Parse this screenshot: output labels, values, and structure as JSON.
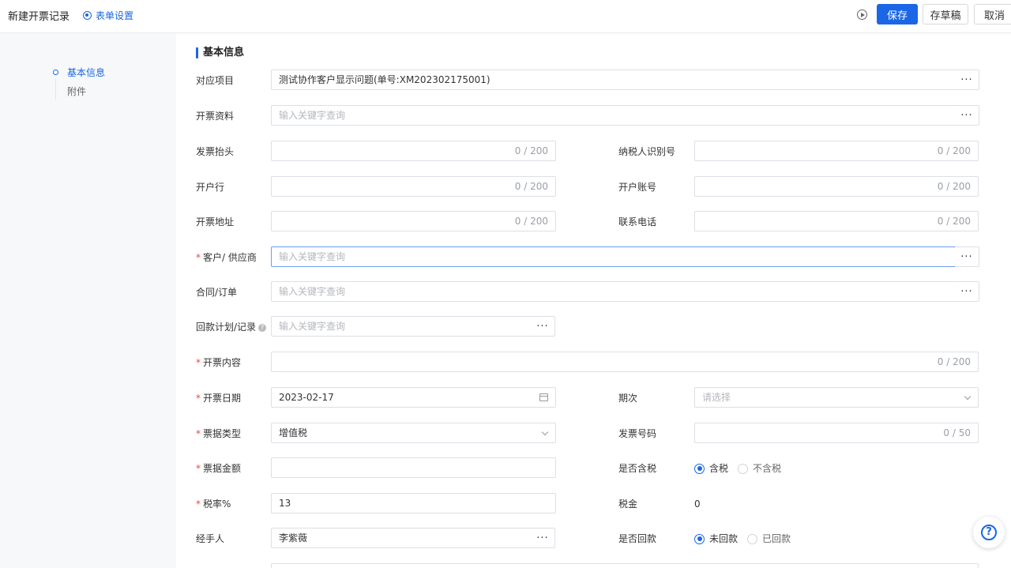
{
  "header": {
    "title": "新建开票记录",
    "form_settings": "表单设置",
    "save": "保存",
    "draft": "存草稿",
    "cancel": "取消"
  },
  "sidenav": {
    "items": [
      "基本信息",
      "附件"
    ]
  },
  "section": {
    "title": "基本信息"
  },
  "fields": {
    "project": {
      "label": "对应项目",
      "value": "测试协作客户显示问题(单号:XM202302175001)"
    },
    "invoice_info": {
      "label": "开票资料",
      "placeholder": "输入关键字查询"
    },
    "invoice_header": {
      "label": "发票抬头",
      "counter": "0 / 200"
    },
    "taxpayer_id": {
      "label": "纳税人识别号",
      "counter": "0 / 200"
    },
    "bank": {
      "label": "开户行",
      "counter": "0 / 200"
    },
    "account": {
      "label": "开户账号",
      "counter": "0 / 200"
    },
    "address": {
      "label": "开票地址",
      "counter": "0 / 200"
    },
    "phone": {
      "label": "联系电话",
      "counter": "0 / 200"
    },
    "customer": {
      "label": "客户/ 供应商",
      "placeholder": "输入关键字查询"
    },
    "contract": {
      "label": "合同/订单",
      "placeholder": "输入关键字查询"
    },
    "payment_plan": {
      "label": "回款计划/记录",
      "placeholder": "输入关键字查询"
    },
    "content": {
      "label": "开票内容",
      "counter": "0 / 200"
    },
    "date": {
      "label": "开票日期",
      "value": "2023-02-17"
    },
    "period": {
      "label": "期次",
      "placeholder": "请选择"
    },
    "ticket_type": {
      "label": "票据类型",
      "value": "增值税"
    },
    "invoice_no": {
      "label": "发票号码",
      "counter": "0 / 50"
    },
    "amount": {
      "label": "票据金额"
    },
    "tax_included": {
      "label": "是否含税",
      "options": [
        "含税",
        "不含税"
      ],
      "selected": "含税"
    },
    "tax_rate": {
      "label": "税率%",
      "value": "13"
    },
    "tax": {
      "label": "税金",
      "value": "0"
    },
    "handler": {
      "label": "经手人",
      "value": "李紫薇"
    },
    "paid_back": {
      "label": "是否回款",
      "options": [
        "未回款",
        "已回款"
      ],
      "selected": "未回款"
    }
  },
  "colors": {
    "accent": "#1a66e6",
    "required": "#e04a4a"
  }
}
